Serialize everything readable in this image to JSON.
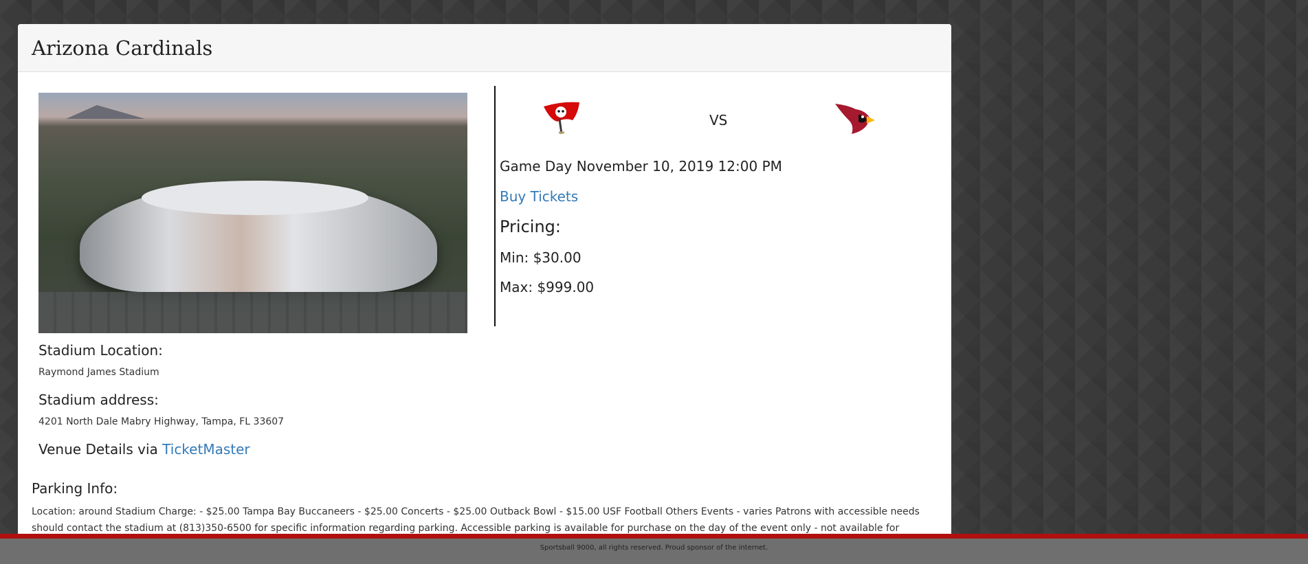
{
  "header": {
    "title": "Arizona Cardinals"
  },
  "matchup": {
    "away_logo": "buccaneers-flag-icon",
    "home_logo": "cardinal-head-icon",
    "vs_label": "VS",
    "game_day": "Game Day November 10, 2019 12:00 PM",
    "buy_tickets_label": "Buy Tickets"
  },
  "pricing": {
    "heading": "Pricing:",
    "min": "Min: $30.00",
    "max": "Max: $999.00"
  },
  "stadium": {
    "location_heading": "Stadium Location:",
    "location_value": "Raymond James Stadium",
    "address_heading": "Stadium address:",
    "address_value": "4201 North Dale Mabry Highway, Tampa, FL 33607",
    "venue_prefix": "Venue Details via ",
    "venue_link_label": "TicketMaster"
  },
  "parking": {
    "heading": "Parking Info:",
    "text": "Location: around Stadium Charge: - $25.00 Tampa Bay Buccaneers - $25.00 Concerts - $25.00 Outback Bowl - $15.00 USF Football Others Events - varies Patrons with accessible needs should contact the stadium at (813)350-6500 for specific information regarding parking. Accessible parking is available for purchase on the day of the event only - not available for advance purchase."
  },
  "footer": {
    "text": "Sportsball 9000, all rights reserved. Proud sponsor of the internet."
  },
  "colors": {
    "link": "#337ab7",
    "footer_accent": "#b01010",
    "footer_bg": "#6f6f6f"
  }
}
